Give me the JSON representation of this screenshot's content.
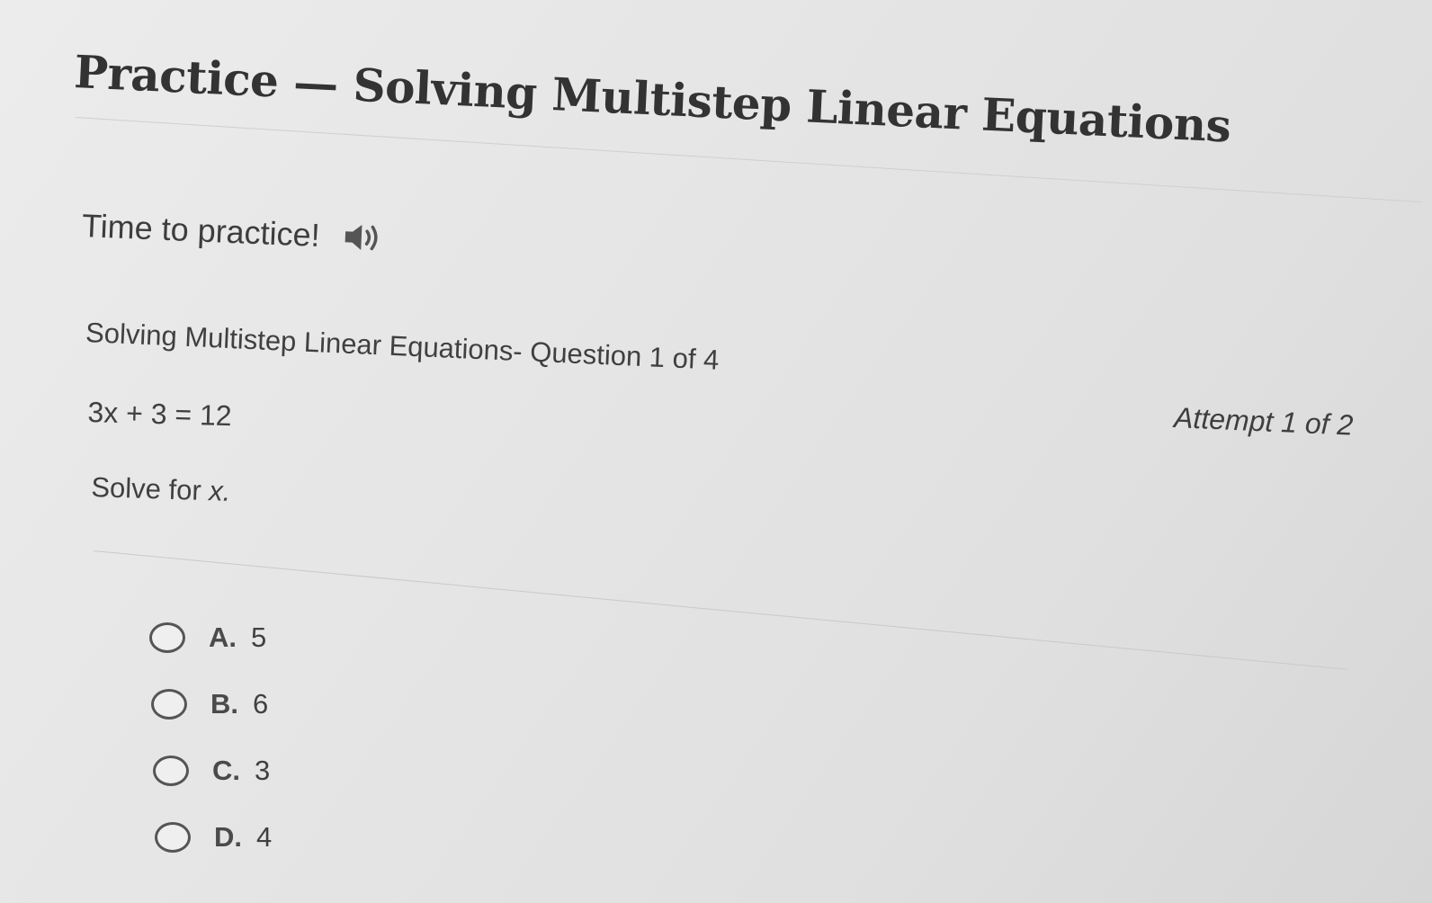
{
  "page": {
    "title": "Practice — Solving Multistep Linear Equations"
  },
  "intro": {
    "text": "Time to practice!",
    "audio_icon": "speaker-icon"
  },
  "question": {
    "header": "Solving Multistep Linear Equations- Question 1 of 4",
    "equation": "3x + 3 = 12",
    "instruction_prefix": "Solve for ",
    "instruction_variable": "x.",
    "attempt": "Attempt 1 of 2"
  },
  "options": [
    {
      "letter": "A.",
      "value": "5"
    },
    {
      "letter": "B.",
      "value": "6"
    },
    {
      "letter": "C.",
      "value": "3"
    },
    {
      "letter": "D.",
      "value": "4"
    }
  ]
}
